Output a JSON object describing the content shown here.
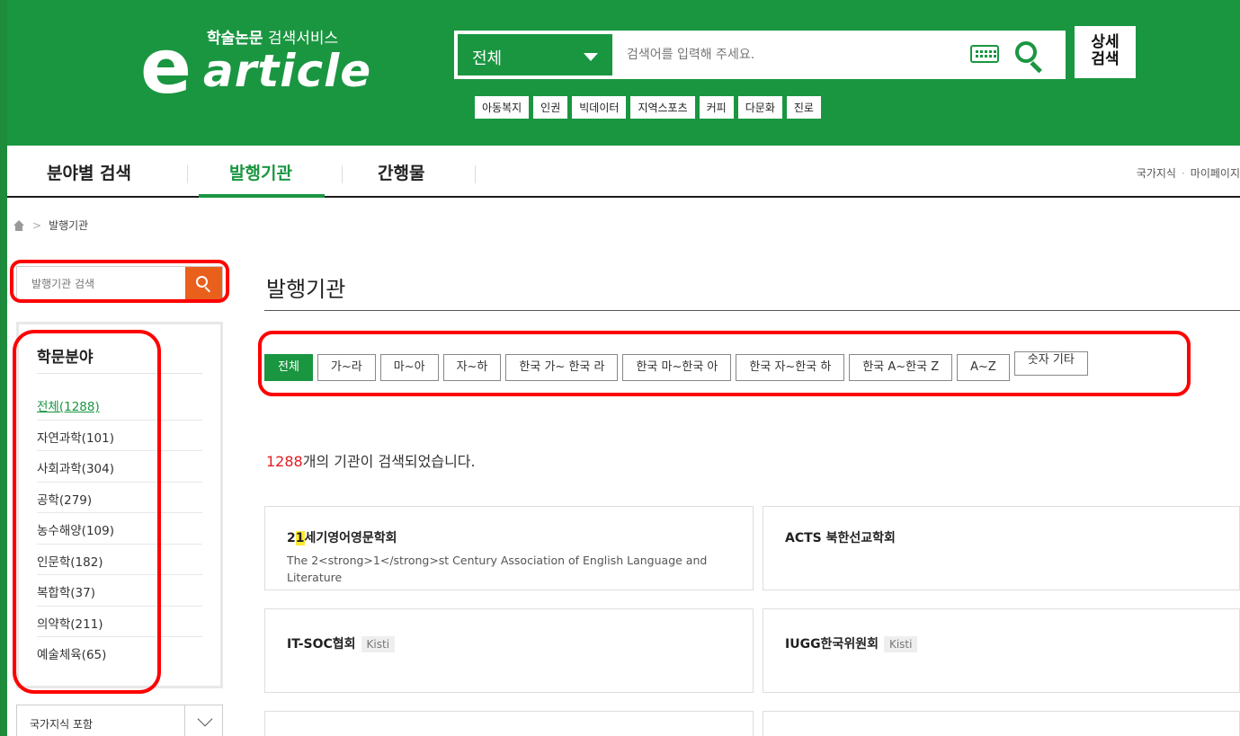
{
  "header": {
    "logo_subtitle_bold": "학술논문",
    "logo_subtitle": "검색서비스",
    "logo_word": "article",
    "logo_letter": "e",
    "search_scope": "전체",
    "search_placeholder": "검색어를 입력해 주세요.",
    "advanced_search_line1": "상세",
    "advanced_search_line2": "검색",
    "tags": [
      "아동복지",
      "인권",
      "빅데이터",
      "지역스포츠",
      "커피",
      "다문화",
      "진로"
    ]
  },
  "nav": {
    "items": [
      "분야별 검색",
      "발행기관",
      "간행물"
    ],
    "right_links": [
      "국가지식",
      "마이페이지"
    ]
  },
  "breadcrumb": {
    "current": "발행기관"
  },
  "sidebar": {
    "search_placeholder": "발행기관 검색",
    "field_title": "학문분야",
    "fields": [
      "전체(1288)",
      "자연과학(101)",
      "사회과학(304)",
      "공학(279)",
      "농수해양(109)",
      "인문학(182)",
      "복합학(37)",
      "의약학(211)",
      "예술체육(65)"
    ],
    "include_select": "국가지식 포함"
  },
  "main": {
    "title": "발행기관",
    "filters": [
      "전체",
      "가~라",
      "마~아",
      "자~하",
      "한국 가~ 한국 라",
      "한국 마~한국 아",
      "한국 자~한국 하",
      "한국 A~한국 Z",
      "A~Z",
      "숫자 기타"
    ],
    "result_number": "1288",
    "result_text": "개의 기관이 검색되었습니다.",
    "cards": [
      {
        "name_prefix": "2",
        "name_highlight": "1",
        "name_suffix": "세기영어영문학회",
        "description": "The 2<strong>1</strong>st Century Association of English Language and Literature"
      },
      {
        "name": "ACTS 북한선교학회"
      },
      {
        "name": "IT-SOC협회",
        "badge": "Kisti"
      },
      {
        "name": "IUGG한국위원회",
        "badge": "Kisti"
      }
    ]
  },
  "colors": {
    "brand_green": "#1a9641",
    "search_orange": "#e8601c",
    "count_red": "#e31b23",
    "annotation_red": "#ff0000",
    "highlight_yellow": "#ffe835"
  }
}
